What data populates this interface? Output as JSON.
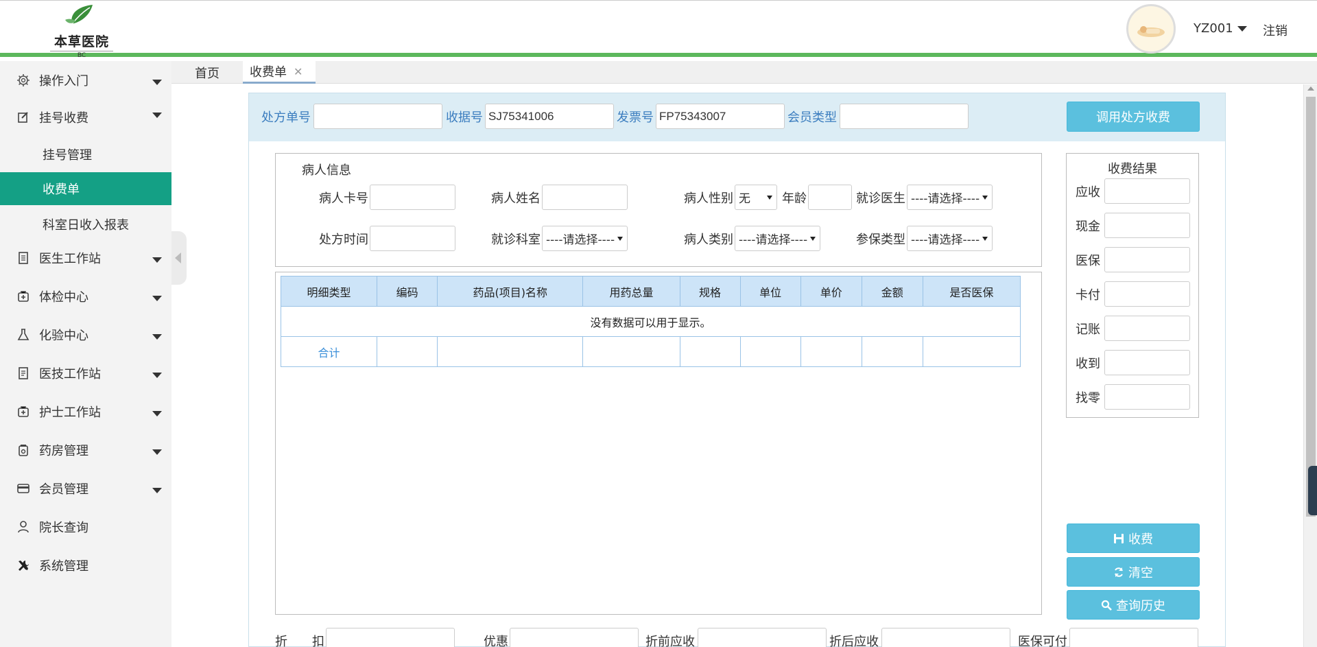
{
  "header": {
    "logo_name": "本草医院",
    "logo_sub": "BC",
    "user": "YZ001",
    "logout": "注销"
  },
  "sidebar": {
    "items": [
      {
        "label": "操作入门",
        "icon": "gear-icon"
      },
      {
        "label": "挂号收费",
        "icon": "edit-icon"
      },
      {
        "label": "医生工作站",
        "icon": "document-icon"
      },
      {
        "label": "体检中心",
        "icon": "medkit-icon"
      },
      {
        "label": "化验中心",
        "icon": "flask-icon"
      },
      {
        "label": "医技工作站",
        "icon": "list-icon"
      },
      {
        "label": "护士工作站",
        "icon": "medkit-icon"
      },
      {
        "label": "药房管理",
        "icon": "pill-icon"
      },
      {
        "label": "会员管理",
        "icon": "card-icon"
      },
      {
        "label": "院长查询",
        "icon": "user-icon"
      },
      {
        "label": "系统管理",
        "icon": "tools-icon"
      }
    ],
    "sub_items": [
      "挂号管理",
      "收费单",
      "科室日收入报表"
    ]
  },
  "tabs": {
    "home": "首页",
    "active": "收费单",
    "close": "✕"
  },
  "form": {
    "prescription_no_label": "处方单号",
    "prescription_no": "",
    "receipt_no_label": "收据号",
    "receipt_no": "SJ75341006",
    "invoice_no_label": "发票号",
    "invoice_no": "FP75343007",
    "member_type_label": "会员类型",
    "member_type": "",
    "call_button": "调用处方收费"
  },
  "patient": {
    "title": "病人信息",
    "card_no_label": "病人卡号",
    "name_label": "病人姓名",
    "gender_label": "病人性别",
    "gender_value": "无",
    "age_label": "年龄",
    "doctor_label": "就诊医生",
    "doctor_value": "----请选择----",
    "time_label": "处方时间",
    "dept_label": "就诊科室",
    "dept_value": "----请选择----",
    "category_label": "病人类别",
    "category_value": "----请选择----",
    "insurance_label": "参保类型",
    "insurance_value": "----请选择----"
  },
  "detail_table": {
    "columns": [
      "明细类型",
      "编码",
      "药品(项目)名称",
      "用药总量",
      "规格",
      "单位",
      "单价",
      "金额",
      "是否医保"
    ],
    "empty_message": "没有数据可以用于显示。",
    "total_label": "合计"
  },
  "result": {
    "title": "收费结果",
    "fields": [
      "应收",
      "现金",
      "医保",
      "卡付",
      "记账",
      "收到",
      "找零"
    ]
  },
  "actions": {
    "charge": "收费",
    "clear": "清空",
    "history": "查询历史"
  },
  "bottom": {
    "discount_label": "折　　扣",
    "offer_label": "优惠",
    "before_label": "折前应收",
    "after_label": "折后应收",
    "insurance_pay_label": "医保可付"
  },
  "colors": {
    "accent": "#14a085",
    "header_line": "#5cb85c",
    "button": "#5bc0de",
    "label_blue": "#3b7dbf"
  }
}
